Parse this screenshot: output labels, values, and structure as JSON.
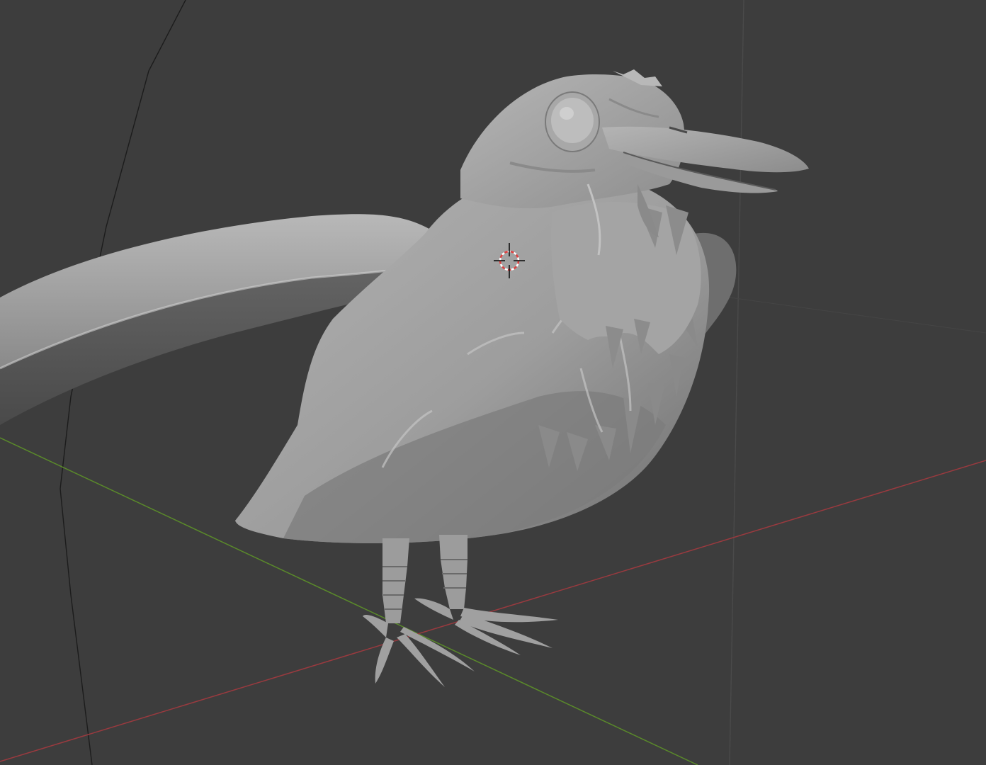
{
  "app": {
    "kind": "3D viewport",
    "mode": "solid shading"
  },
  "viewport": {
    "background_color": "#3d3d3d",
    "axis_x_color": "#9a3a3f",
    "axis_y_color": "#5a8a2a",
    "model_color": "#9d9d9d",
    "cursor": {
      "icon": "3d-cursor-icon",
      "ring_colors": [
        "#e04040",
        "#ffffff"
      ]
    }
  },
  "scene_objects": [
    {
      "name": "crow-sculpt",
      "icon": "mesh-object"
    },
    {
      "name": "curved-perch",
      "icon": "mesh-object"
    }
  ]
}
